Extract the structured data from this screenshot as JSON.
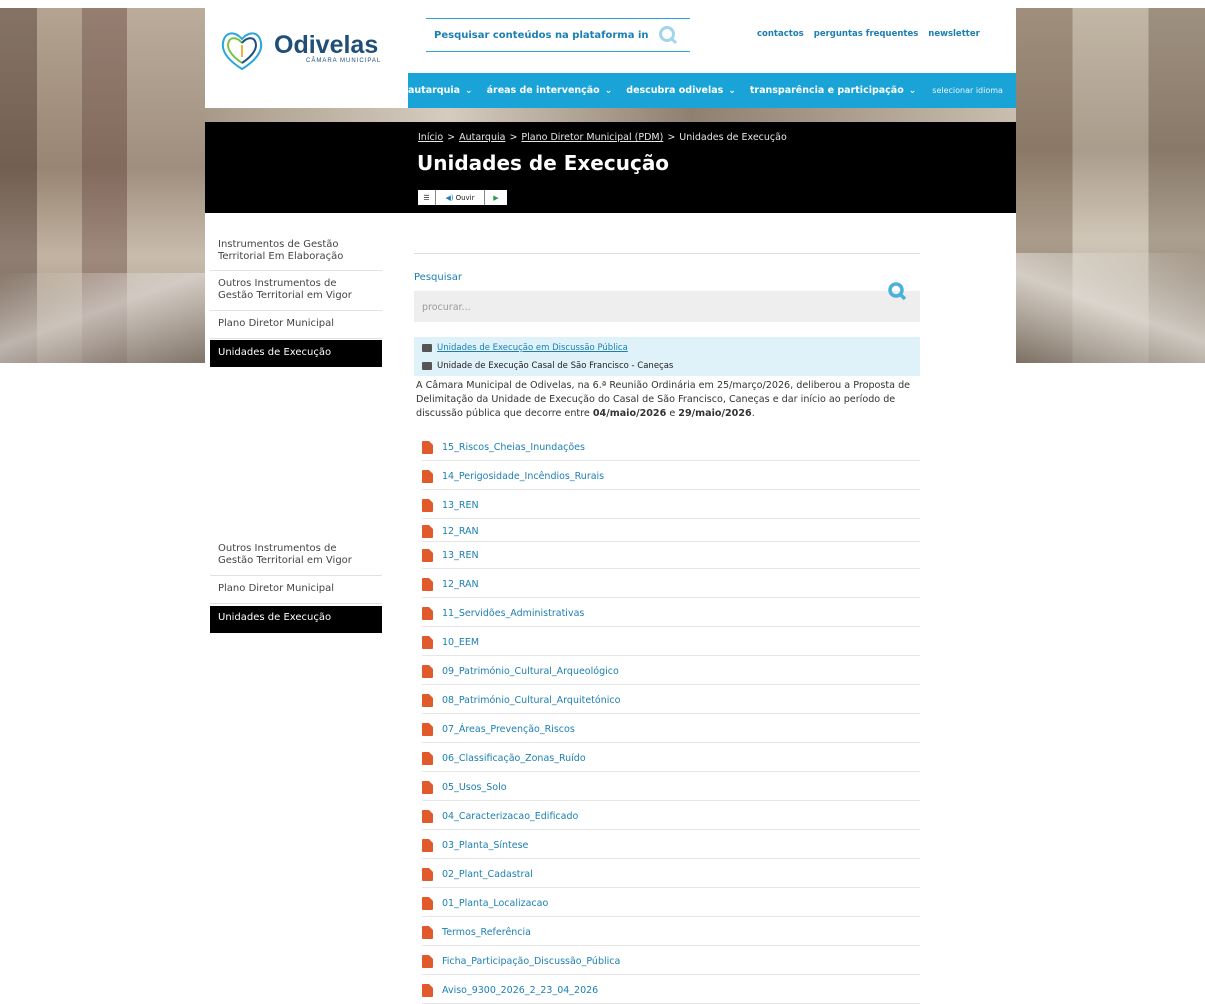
{
  "header": {
    "logo_title": "Odivelas",
    "logo_subtitle": "CÂMARA MUNICIPAL",
    "search_placeholder": "Pesquisar conteúdos na plataforma inte",
    "top_links": [
      "contactos",
      "perguntas frequentes",
      "newsletter"
    ]
  },
  "nav": {
    "items": [
      "autarquia",
      "áreas de intervenção",
      "descubra odivelas",
      "transparência e participação"
    ],
    "language": "selecionar idioma"
  },
  "breadcrumb": {
    "items": [
      "Início",
      "Autarquia",
      "Plano Diretor Municipal (PDM)",
      "Unidades de Execução"
    ],
    "separator": ">"
  },
  "page": {
    "title": "Unidades de Execução",
    "audio_label": "Ouvir"
  },
  "sidebar_top": [
    "Instrumentos de Gestão Territorial Em Elaboração",
    "Outros Instrumentos de Gestão Territorial em Vigor",
    "Plano Diretor Municipal",
    "Unidades de Execução"
  ],
  "sidebar_bottom": [
    "Outros Instrumentos de Gestão Territorial em Vigor",
    "Plano Diretor Municipal",
    "Unidades de Execução"
  ],
  "search": {
    "label": "Pesquisar",
    "placeholder": "procurar..."
  },
  "folders": {
    "parent": "Unidades de Execução em Discussão Pública",
    "current": "Unidade de Execução Casal de São Francisco - Caneças"
  },
  "description": {
    "text": "A Câmara Municipal de Odivelas, na 6.ª Reunião Ordinária em 25/março/2026, deliberou a Proposta de Delimitação da Unidade de Execução do Casal de São Francisco, Caneças e dar início ao período de discussão pública que decorre entre ",
    "date_start": "04/maio/2026",
    "connector": " e ",
    "date_end": "29/maio/2026",
    "end": "."
  },
  "files": [
    "15_Riscos_Cheias_Inundações",
    "14_Perigosidade_Incêndios_Rurais",
    "13_REN",
    "12_RAN",
    "13_REN",
    "12_RAN",
    "11_Servidões_Administrativas",
    "10_EEM",
    "09_Património_Cultural_Arqueológico",
    "08_Património_Cultural_Arquitetónico",
    "07_Áreas_Prevenção_Riscos",
    "06_Classificação_Zonas_Ruído",
    "05_Usos_Solo",
    "04_Caracterizacao_Edificado",
    "03_Planta_Síntese",
    "02_Plant_Cadastral",
    "01_Planta_Localizacao",
    "Termos_Referência",
    "Ficha_Participação_Discussão_Pública",
    "Aviso_9300_2026_2_23_04_2026"
  ],
  "colors": {
    "brand_blue": "#1aa3d6",
    "link_blue": "#1b7fb3",
    "pdf_red": "#e05a2c",
    "logo_blue": "#1f4e79"
  }
}
